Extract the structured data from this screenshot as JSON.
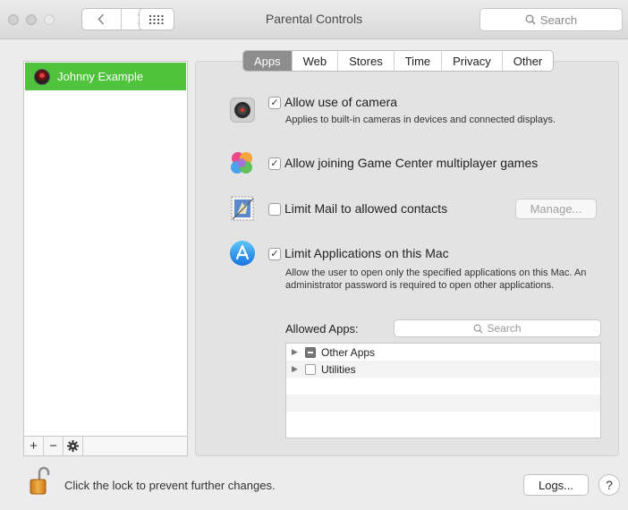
{
  "window": {
    "title": "Parental Controls"
  },
  "toolbar": {
    "back_glyph": "‹",
    "forward_glyph": "›",
    "search_placeholder": "Search"
  },
  "users": [
    {
      "name": "Johnny Example",
      "selected": true
    }
  ],
  "list_buttons": {
    "add": "+",
    "remove": "−",
    "gear": "✱"
  },
  "tabs": [
    {
      "label": "Apps",
      "active": true
    },
    {
      "label": "Web",
      "active": false
    },
    {
      "label": "Stores",
      "active": false
    },
    {
      "label": "Time",
      "active": false
    },
    {
      "label": "Privacy",
      "active": false
    },
    {
      "label": "Other",
      "active": false
    }
  ],
  "options": {
    "camera": {
      "label": "Allow use of camera",
      "desc": "Applies to built-in cameras in devices and connected displays.",
      "checked": true,
      "icon": "camera-icon"
    },
    "gamecenter": {
      "label": "Allow joining Game Center multiplayer games",
      "checked": true,
      "icon": "game-center-icon"
    },
    "mail": {
      "label": "Limit Mail to allowed contacts",
      "checked": false,
      "icon": "mail-stamp-icon",
      "button": "Manage..."
    },
    "apps": {
      "label": "Limit Applications on this Mac",
      "desc": "Allow the user to open only the specified applications on this Mac. An administrator password is required to open other applications.",
      "checked": true,
      "icon": "app-store-icon"
    }
  },
  "allowed_apps": {
    "label": "Allowed Apps:",
    "search_placeholder": "Search",
    "items": [
      {
        "label": "Other Apps",
        "state": "mixed"
      },
      {
        "label": "Utilities",
        "state": "unchecked"
      }
    ]
  },
  "footer": {
    "lock_text": "Click the lock to prevent further changes.",
    "logs_button": "Logs...",
    "help": "?"
  },
  "colors": {
    "selection": "#4ec33b",
    "tab_active": "#8d8d8d",
    "window_bg": "#ececec"
  }
}
